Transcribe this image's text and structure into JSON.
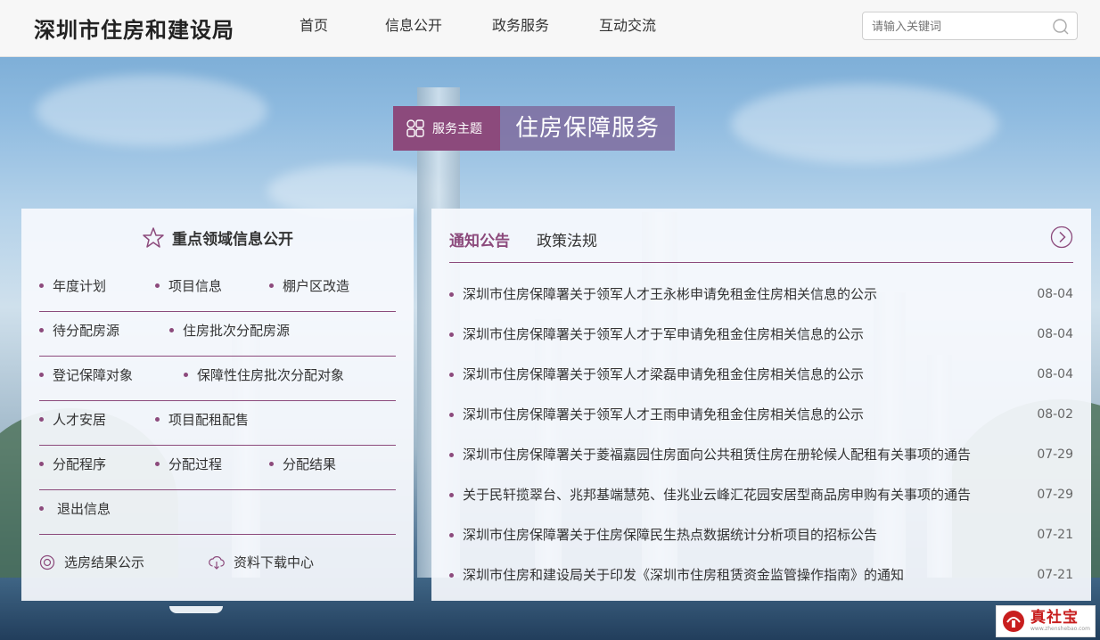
{
  "header": {
    "logo": "深圳市住房和建设局",
    "nav": [
      "首页",
      "信息公开",
      "政务服务",
      "互动交流"
    ],
    "search_placeholder": "请输入关键词"
  },
  "theme": {
    "tag_label": "服务主题",
    "title": "住房保障服务"
  },
  "left_panel": {
    "title": "重点领域信息公开",
    "rows": [
      [
        "年度计划",
        "项目信息",
        "棚户区改造"
      ],
      [
        "待分配房源",
        "住房批次分配房源"
      ],
      [
        "登记保障对象",
        "保障性住房批次分配对象"
      ],
      [
        "人才安居",
        "项目配租配售"
      ],
      [
        "分配程序",
        "分配过程",
        "分配结果"
      ],
      [
        "退出信息"
      ]
    ],
    "bottom_links": [
      "选房结果公示",
      "资料下载中心"
    ]
  },
  "right_panel": {
    "tabs": [
      "通知公告",
      "政策法规"
    ],
    "active_tab": 0,
    "news": [
      {
        "title": "深圳市住房保障署关于领军人才王永彬申请免租金住房相关信息的公示",
        "date": "08-04"
      },
      {
        "title": "深圳市住房保障署关于领军人才于军申请免租金住房相关信息的公示",
        "date": "08-04"
      },
      {
        "title": "深圳市住房保障署关于领军人才梁磊申请免租金住房相关信息的公示",
        "date": "08-04"
      },
      {
        "title": "深圳市住房保障署关于领军人才王雨申请免租金住房相关信息的公示",
        "date": "08-02"
      },
      {
        "title": "深圳市住房保障署关于菱福嘉园住房面向公共租赁住房在册轮候人配租有关事项的通告",
        "date": "07-29"
      },
      {
        "title": "关于民轩揽翠台、兆邦基端慧苑、佳兆业云峰汇花园安居型商品房申购有关事项的通告",
        "date": "07-29"
      },
      {
        "title": "深圳市住房保障署关于住房保障民生热点数据统计分析项目的招标公告",
        "date": "07-21"
      },
      {
        "title": "深圳市住房和建设局关于印发《深圳市住房租赁资金监管操作指南》的通知",
        "date": "07-21"
      }
    ]
  },
  "watermark": {
    "main": "真社宝",
    "sub": "www.zhenshebao.com"
  },
  "colors": {
    "accent": "#8c4a7c",
    "theme_title_bg": "#806ea0"
  }
}
